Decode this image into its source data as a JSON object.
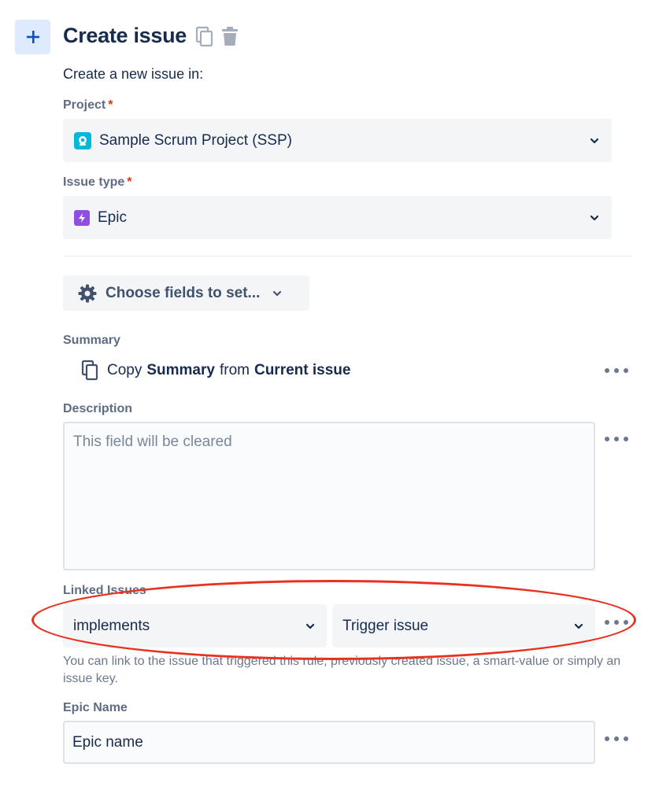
{
  "header": {
    "add_icon": "plus-icon",
    "title": "Create issue",
    "copy_icon": "copy-icon",
    "delete_icon": "trash-icon"
  },
  "intro": "Create a new issue in:",
  "project": {
    "label": "Project",
    "required_mark": "*",
    "value": "Sample Scrum Project (SSP)"
  },
  "issue_type": {
    "label": "Issue type",
    "required_mark": "*",
    "value": "Epic"
  },
  "choose_fields": {
    "label": "Choose fields to set..."
  },
  "summary": {
    "label": "Summary",
    "prefix": "Copy",
    "field": "Summary",
    "middle": "from",
    "source": "Current issue"
  },
  "description": {
    "label": "Description",
    "placeholder": "This field will be cleared"
  },
  "linked_issues": {
    "label": "Linked Issues",
    "link_type": "implements",
    "target": "Trigger issue",
    "help": "You can link to the issue that triggered this rule, previously created issue, a smart-value or simply an issue key."
  },
  "epic_name": {
    "label": "Epic Name",
    "value": "Epic name"
  },
  "colors": {
    "accent": "#0052cc",
    "annotation": "#e8321f"
  }
}
